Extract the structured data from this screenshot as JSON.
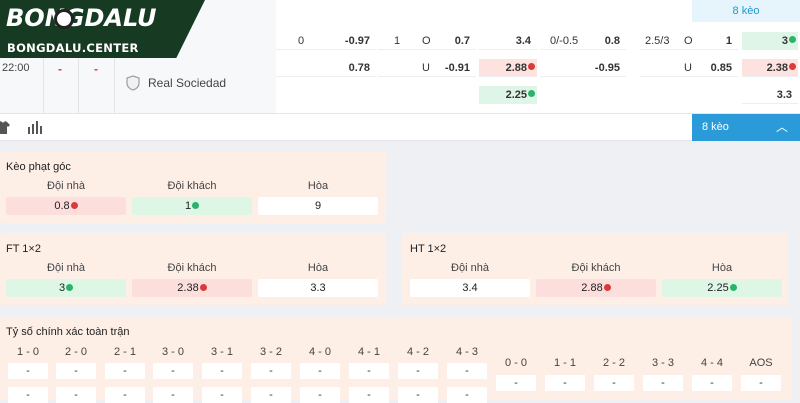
{
  "brand": {
    "name": "BONGDALU",
    "site": "BONGDALU.CENTER"
  },
  "match": {
    "time": "22:00",
    "score_home": "-",
    "score_away": "-",
    "away_team": "Real Sociedad"
  },
  "odds_rows": {
    "row1": {
      "hdp_line": "0",
      "hdp_val": "-0.97",
      "ou_line": "1",
      "ou_side": "O",
      "ou_val": "0.7",
      "x12_val": "3.4",
      "h1_line": "0/-0.5",
      "h1_val": "0.8",
      "h1_ou_line": "2.5/3",
      "h1_ou_side": "O",
      "h1_ou_val": "1",
      "h1_x12_val": "3"
    },
    "row2": {
      "hdp_val": "0.78",
      "ou_side": "U",
      "ou_val": "-0.91",
      "x12_val": "2.88",
      "h1_val": "-0.95",
      "h1_ou_side": "U",
      "h1_ou_val": "0.85",
      "h1_x12_val": "2.38"
    },
    "row3": {
      "x12_val": "2.25",
      "h1_x12_val": "3.3"
    }
  },
  "toolbar": {
    "more_markets_top": "8 kèo",
    "more_markets": "8 kèo",
    "toggle_icon": "chevron-up-icon"
  },
  "icons": {
    "lineup": "shirt-icon",
    "stats": "bar-chart-icon",
    "team_badge": "shield-icon"
  },
  "colors": {
    "up": "#2bb36b",
    "down": "#d93a3a",
    "accent": "#2a9ad8",
    "brand": "#173a23"
  },
  "corners": {
    "title": "Kèo phạt góc",
    "home_label": "Đội nhà",
    "away_label": "Đội khách",
    "draw_label": "Hòa",
    "home": "0.8",
    "away": "1",
    "draw": "9"
  },
  "ft12": {
    "title": "FT 1×2",
    "home_label": "Đội nhà",
    "away_label": "Đội khách",
    "draw_label": "Hòa",
    "home": "3",
    "away": "2.38",
    "draw": "3.3"
  },
  "ht12": {
    "title": "HT 1×2",
    "home_label": "Đội nhà",
    "away_label": "Đội khách",
    "draw_label": "Hòa",
    "home": "3.4",
    "away": "2.88",
    "draw": "2.25"
  },
  "correct_score": {
    "title": "Tỷ số chính xác toàn trận",
    "row1": [
      "1 - 0",
      "2 - 0",
      "2 - 1",
      "3 - 0",
      "3 - 1",
      "3 - 2",
      "4 - 0",
      "4 - 1",
      "4 - 2",
      "4 - 3"
    ],
    "row2": [
      "0 - 0",
      "1 - 1",
      "2 - 2",
      "3 - 3",
      "4 - 4",
      "AOS"
    ],
    "empty": "-"
  }
}
